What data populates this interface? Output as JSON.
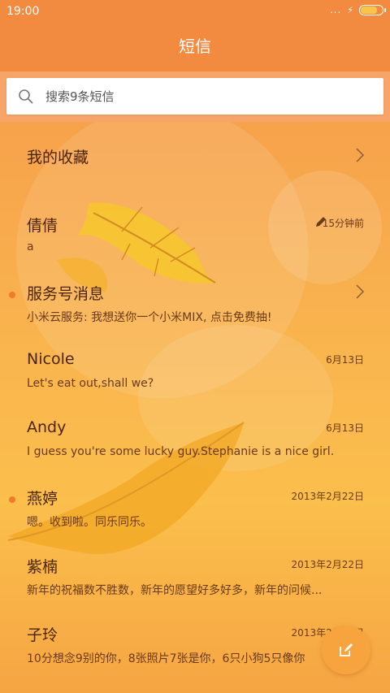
{
  "status_bar": {
    "time": "19:00",
    "dots": "...",
    "flash": "⚡"
  },
  "header": {
    "title": "短信"
  },
  "search": {
    "placeholder": "搜索9条短信"
  },
  "conversations": [
    {
      "name": "我的收藏",
      "preview": "",
      "date": "",
      "has_chevron": true,
      "unread": false
    },
    {
      "name": "倩倩",
      "preview": "a",
      "date": "15分钟前",
      "draft": true,
      "unread": false
    },
    {
      "name": "服务号消息",
      "preview": "小米云服务: 我想送你一个小米MIX, 点击免费抽!",
      "date": "",
      "has_chevron": true,
      "unread": true
    },
    {
      "name": "Nicole",
      "preview": "Let's eat out,shall we?",
      "date": "6月13日",
      "unread": false
    },
    {
      "name": "Andy",
      "preview": "I guess you're some lucky guy.Stephanie is a nice girl.",
      "date": "6月13日",
      "unread": false
    },
    {
      "name": "燕婷",
      "preview": "嗯。收到啦。同乐同乐。",
      "date": "2013年2月22日",
      "unread": true
    },
    {
      "name": "紫楠",
      "preview": "新年的祝福数不胜数，新年的愿望好多好多，新年的问候...",
      "date": "2013年2月22日",
      "unread": false
    },
    {
      "name": "子玲",
      "preview": "10分想念9别的你，8张照片7张是你，6只小狗5只像你",
      "date": "2013年2月22日",
      "unread": false
    }
  ],
  "icons": {
    "search": "search-icon",
    "chevron": "chevron-right-icon",
    "pencil": "pencil-icon",
    "compose": "compose-icon"
  },
  "colors": {
    "accent": "#f28a3f",
    "unread_dot": "#f07a2a",
    "fab": "#f7a43f"
  }
}
